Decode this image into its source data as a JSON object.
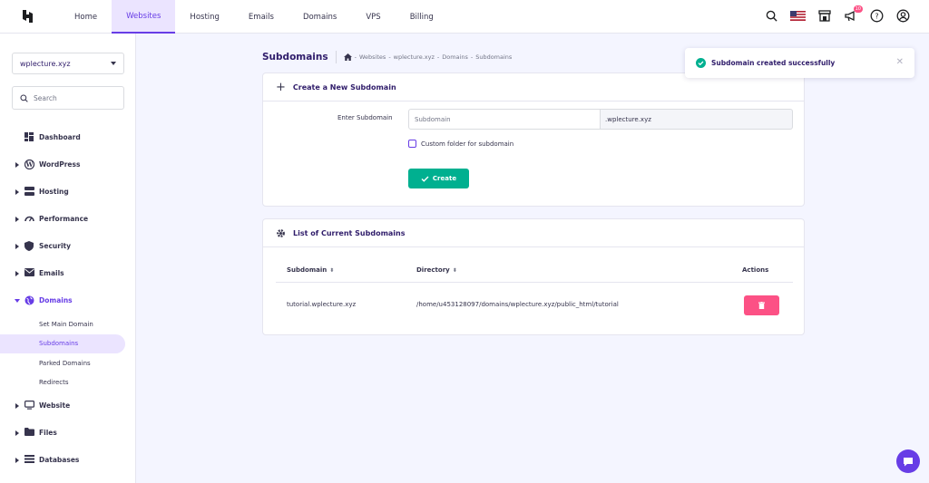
{
  "nav": {
    "links": [
      "Home",
      "Websites",
      "Hosting",
      "Emails",
      "Domains",
      "VPS",
      "Billing"
    ],
    "active_index": 1,
    "notification_count": "10"
  },
  "sidebar": {
    "site": "wplecture.xyz",
    "search_placeholder": "Search",
    "items": [
      {
        "label": "Dashboard",
        "icon": "dashboard-icon",
        "arrow": false
      },
      {
        "label": "WordPress",
        "icon": "wordpress-icon",
        "arrow": true
      },
      {
        "label": "Hosting",
        "icon": "server-icon",
        "arrow": true
      },
      {
        "label": "Performance",
        "icon": "gauge-icon",
        "arrow": true
      },
      {
        "label": "Security",
        "icon": "shield-icon",
        "arrow": true
      },
      {
        "label": "Emails",
        "icon": "mail-icon",
        "arrow": true
      },
      {
        "label": "Domains",
        "icon": "globe-icon",
        "arrow": true,
        "expanded": true
      }
    ],
    "domain_sub": [
      "Set Main Domain",
      "Subdomains",
      "Parked Domains",
      "Redirects"
    ],
    "items_after": [
      {
        "label": "Website",
        "icon": "monitor-icon"
      },
      {
        "label": "Files",
        "icon": "folder-icon"
      },
      {
        "label": "Databases",
        "icon": "database-icon"
      }
    ]
  },
  "page": {
    "title": "Subdomains",
    "breadcrumbs": [
      "Websites",
      "wplecture.xyz",
      "Domains",
      "Subdomains"
    ]
  },
  "create_card": {
    "title": "Create a New Subdomain",
    "label": "Enter Subdomain",
    "placeholder": "Subdomain",
    "suffix": ".wplecture.xyz",
    "checkbox_label": "Custom folder for subdomain",
    "button": "Create"
  },
  "list_card": {
    "title": "List of Current Subdomains",
    "columns": [
      "Subdomain",
      "Directory",
      "Actions"
    ],
    "rows": [
      {
        "subdomain": "tutorial.wplecture.xyz",
        "directory": "/home/u453128097/domains/wplecture.xyz/public_html/tutorial"
      }
    ]
  },
  "toast": {
    "message": "Subdomain created successfully"
  },
  "colors": {
    "primary": "#673de6",
    "success": "#00b090",
    "danger": "#fc5185"
  }
}
